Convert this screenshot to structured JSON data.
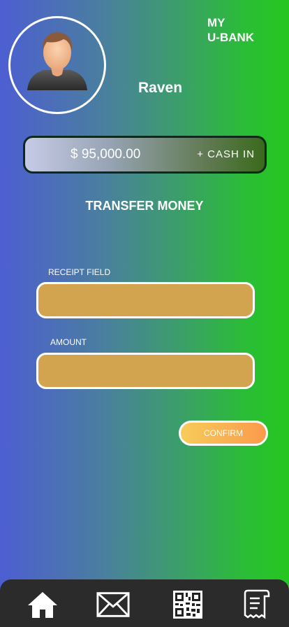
{
  "header": {
    "brand_line1": "MY",
    "brand_line2": "U-BANK",
    "username": "Raven"
  },
  "balance": {
    "amount": "$ 95,000.00",
    "cash_in_label": "+ CASH IN"
  },
  "transfer": {
    "title": "TRANSFER MONEY",
    "receipt_label": "RECEIPT FIELD",
    "receipt_value": "",
    "amount_label": "AMOUNT",
    "amount_value": "",
    "confirm_label": "CONFIRM"
  },
  "nav": {
    "items": [
      {
        "icon": "home-icon"
      },
      {
        "icon": "mail-icon"
      },
      {
        "icon": "qr-code-icon"
      },
      {
        "icon": "receipt-icon"
      }
    ]
  },
  "colors": {
    "field_fill": "#d2a450",
    "confirm_start": "#f8cc5a",
    "confirm_end": "#fa9a4c",
    "nav_bg": "#2b2b2b"
  }
}
